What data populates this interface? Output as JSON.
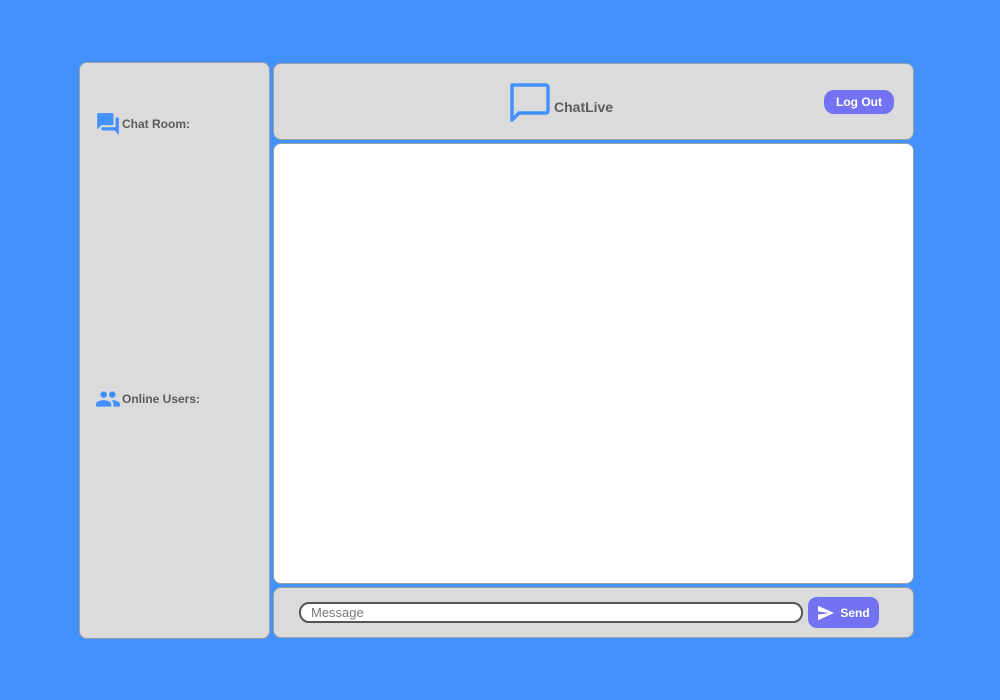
{
  "colors": {
    "background": "#4391fd",
    "panel": "#dbdbdb",
    "accent_icon": "#4391fd",
    "button": "#7272f2",
    "button_text": "#ffffff"
  },
  "sidebar": {
    "chat_room": {
      "icon": "forum-icon",
      "label": "Chat Room:"
    },
    "online_users": {
      "icon": "people-icon",
      "label": "Online Users:"
    }
  },
  "header": {
    "brand_icon": "chat-bubble-icon",
    "brand_name": "ChatLive",
    "logout_label": "Log Out"
  },
  "messages": [],
  "composer": {
    "input_value": "",
    "input_placeholder": "Message",
    "send_icon": "send-icon",
    "send_label": "Send"
  }
}
